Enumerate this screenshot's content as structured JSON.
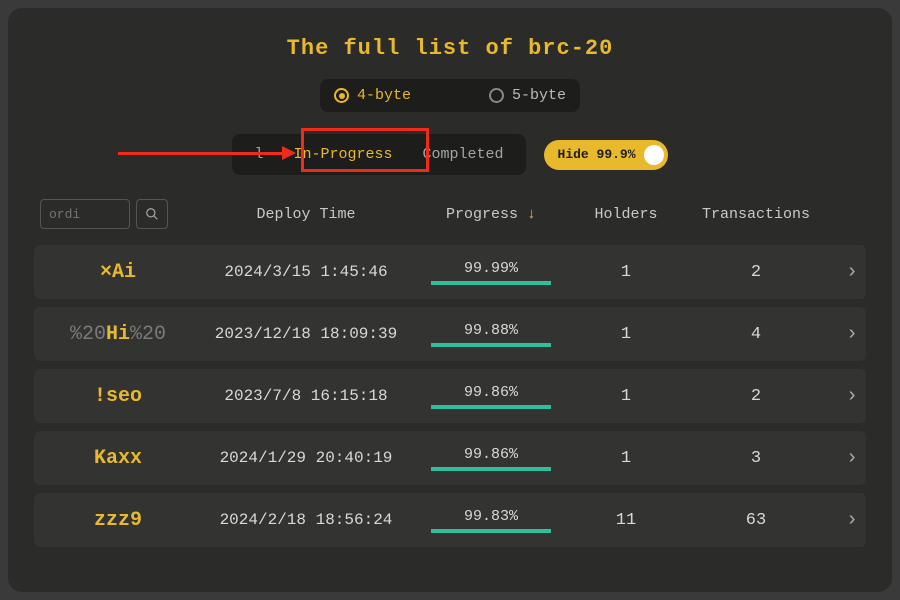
{
  "title": "The full list of brc-20",
  "byte_toggle": {
    "opt1": "4-byte",
    "opt2": "5-byte",
    "selected": "4-byte"
  },
  "status_tabs": {
    "all_visible_fragment": "l",
    "in_progress": "In-Progress",
    "completed": "Completed",
    "active": "In-Progress"
  },
  "hide_pill": "Hide 99.9%",
  "search": {
    "placeholder": "ordi"
  },
  "columns": {
    "deploy": "Deploy Time",
    "progress": "Progress",
    "sort_arrow": "↓",
    "holders": "Holders",
    "transactions": "Transactions"
  },
  "rows": [
    {
      "ticker_pre": "",
      "ticker_core": "×Ai",
      "ticker_post": "",
      "deploy": "2024/3/15 1:45:46",
      "progress": "99.99%",
      "holders": "1",
      "tx": "2"
    },
    {
      "ticker_pre": "%20",
      "ticker_core": "Hi",
      "ticker_post": "%20",
      "deploy": "2023/12/18 18:09:39",
      "progress": "99.88%",
      "holders": "1",
      "tx": "4"
    },
    {
      "ticker_pre": "",
      "ticker_core": "!seo",
      "ticker_post": "",
      "deploy": "2023/7/8 16:15:18",
      "progress": "99.86%",
      "holders": "1",
      "tx": "2"
    },
    {
      "ticker_pre": "",
      "ticker_core": "Kaxx",
      "ticker_post": "",
      "deploy": "2024/1/29 20:40:19",
      "progress": "99.86%",
      "holders": "1",
      "tx": "3"
    },
    {
      "ticker_pre": "",
      "ticker_core": "zzz9",
      "ticker_post": "",
      "deploy": "2024/2/18 18:56:24",
      "progress": "99.83%",
      "holders": "11",
      "tx": "63"
    }
  ]
}
